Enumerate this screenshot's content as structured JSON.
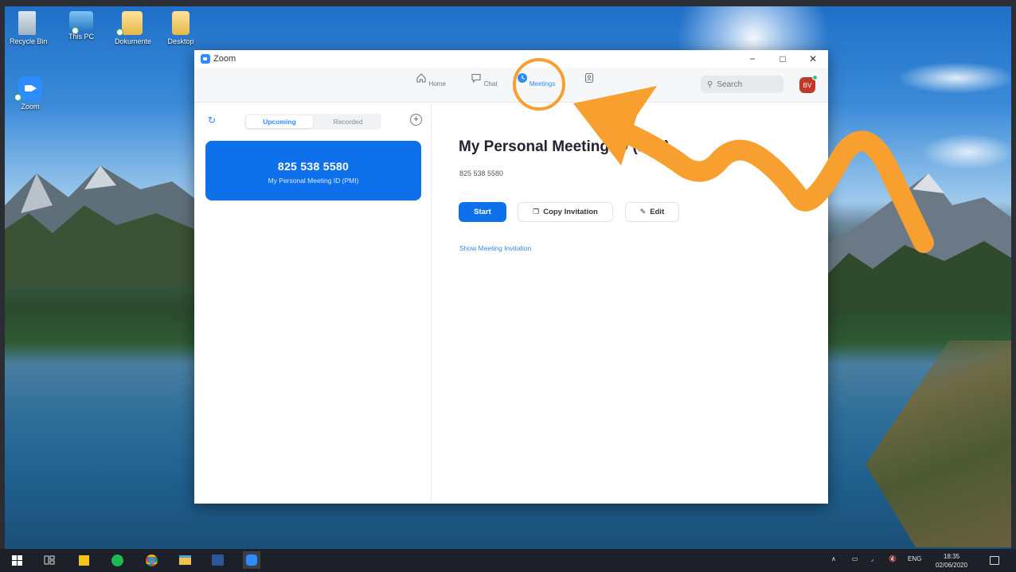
{
  "desktop": {
    "icons": [
      {
        "label": "Recycle Bin"
      },
      {
        "label": "This PC"
      },
      {
        "label": "Dokumente"
      },
      {
        "label": "Desktop"
      },
      {
        "label": "Zoom"
      }
    ]
  },
  "window": {
    "title": "Zoom",
    "controls": {
      "minimize": "−",
      "maximize": "□",
      "close": "✕"
    }
  },
  "nav": {
    "items": [
      {
        "label": "Home",
        "icon": "home-icon"
      },
      {
        "label": "Chat",
        "icon": "chat-icon"
      },
      {
        "label": "Meetings",
        "icon": "meetings-icon",
        "active": true
      },
      {
        "label": "",
        "icon": "contacts-icon"
      }
    ],
    "search_placeholder": "Search",
    "avatar_initials": "BV"
  },
  "left_pane": {
    "tabs": [
      {
        "label": "Upcoming",
        "active": true
      },
      {
        "label": "Recorded"
      }
    ],
    "add_symbol": "+",
    "meeting_card": {
      "id": "825 538 5580",
      "subtitle": "My Personal Meeting ID (PMI)"
    }
  },
  "right_pane": {
    "title": "My Personal Meeting ID (PMI)",
    "meeting_id": "825 538 5580",
    "start_label": "Start",
    "copy_invitation_label": "Copy Invitation",
    "edit_label": "Edit",
    "show_invitation_label": "Show Meeting Invitation"
  },
  "taskbar": {
    "language": "ENG",
    "time": "18:35",
    "date": "02/06/2020"
  },
  "colors": {
    "zoom_blue": "#0e71eb",
    "accent_blue": "#2d8cff",
    "annotation_orange": "#f7a030"
  }
}
